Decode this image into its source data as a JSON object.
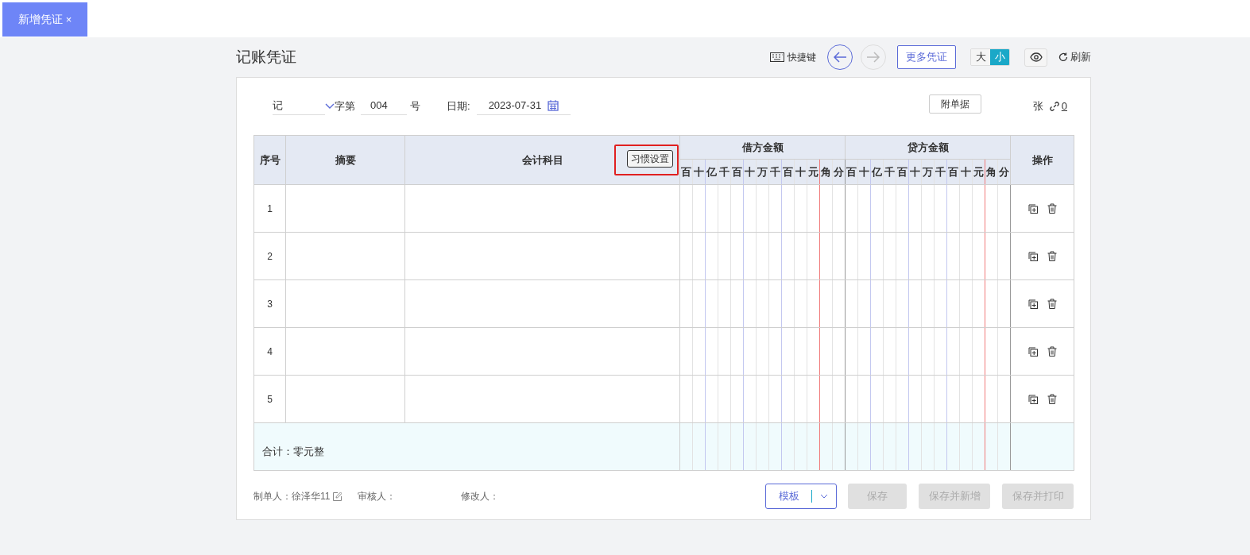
{
  "tab": {
    "label": "新增凭证",
    "close": "×"
  },
  "title": "记账凭证",
  "toolbar": {
    "shortcut": "快捷键",
    "prev_disabled": false,
    "next_disabled": true,
    "more": "更多凭证",
    "sizes": [
      {
        "label": "大",
        "selected": false
      },
      {
        "label": "小",
        "selected": true
      }
    ],
    "refresh": "刷新"
  },
  "voucher": {
    "word": "记",
    "word_suffix": "字第",
    "number": "004",
    "number_suffix": "号",
    "date_label": "日期:",
    "date": "2023-07-31",
    "attach_button": "附单据",
    "sheets_label": "张",
    "attachment_count": "0"
  },
  "table": {
    "columns": [
      "序号",
      "摘要",
      "会计科目",
      "借方金额",
      "贷方金额",
      "操作"
    ],
    "settings_button": {
      "label": "习惯设置",
      "highlighted": true
    },
    "debit_digits": [
      "百",
      "十",
      "亿",
      "千",
      "百",
      "十",
      "万",
      "千",
      "百",
      "十",
      "元",
      "角",
      "分"
    ],
    "credit_digits": [
      "百",
      "十",
      "亿",
      "千",
      "百",
      "十",
      "万",
      "千",
      "百",
      "十",
      "元",
      "角",
      "分"
    ],
    "rows": [
      {
        "index": "1"
      },
      {
        "index": "2"
      },
      {
        "index": "3"
      },
      {
        "index": "4"
      },
      {
        "index": "5"
      }
    ],
    "total": "合计：零元整"
  },
  "footer": {
    "maker_label": "制单人：",
    "maker": "徐泽华11",
    "reviewer_label": "审核人：",
    "modifier_label": "修改人：",
    "template": "模板",
    "buttons": [
      {
        "label": "保存",
        "disabled": true
      },
      {
        "label": "保存并新增",
        "disabled": true
      },
      {
        "label": "保存并打印",
        "disabled": true
      }
    ]
  }
}
